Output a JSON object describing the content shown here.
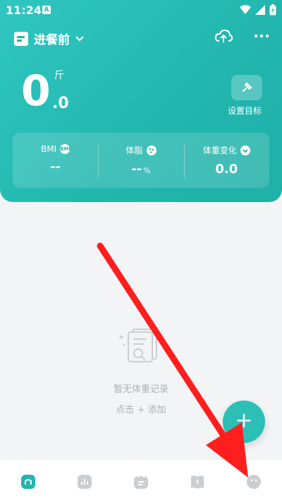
{
  "status": {
    "time": "11:24",
    "app_badge": "A"
  },
  "header": {
    "meal_label": "进餐前",
    "weight_int": "0",
    "weight_dec": ".0",
    "weight_unit": "斤",
    "goal_label": "设置目标"
  },
  "stats": [
    {
      "label": "BMI",
      "icon": "BMI",
      "value": "--",
      "unit": ""
    },
    {
      "label": "体脂",
      "icon": "info-icon",
      "value": "--",
      "unit": "%"
    },
    {
      "label": "体重变化",
      "icon": "chevron-down-icon",
      "value": "0.0",
      "unit": ""
    }
  ],
  "empty": {
    "text": "暂无体重记录",
    "sub": "点击 + 添加"
  },
  "fab": {
    "label": "+"
  },
  "tabs": [
    {
      "name": "tab-home",
      "icon": "home-icon"
    },
    {
      "name": "tab-stats",
      "icon": "bar-chart-icon"
    },
    {
      "name": "tab-records",
      "icon": "calendar-icon"
    },
    {
      "name": "tab-tips",
      "icon": "book-icon"
    },
    {
      "name": "tab-profile",
      "icon": "face-icon"
    }
  ],
  "colors": {
    "accent": "#22b6ae",
    "annotation_arrow": "#ff1f1f"
  }
}
